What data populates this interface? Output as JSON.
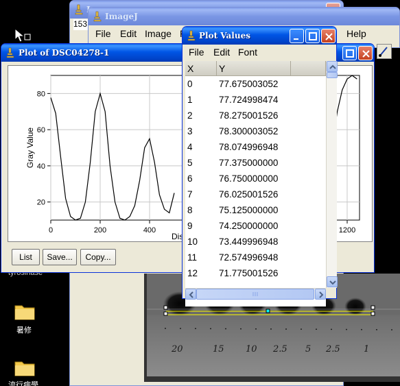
{
  "imagej_back": {
    "title": "I",
    "field_value": "153"
  },
  "imagej": {
    "title": "ImageJ",
    "menu": [
      "File",
      "Edit",
      "Image",
      "P",
      "Help"
    ]
  },
  "desktop": {
    "icons": [
      {
        "label": "tyrosinase",
        "icon": "folder-icon"
      },
      {
        "label": "暑修",
        "icon": "folder-icon"
      },
      {
        "label": "流行病學",
        "icon": "folder-icon"
      }
    ]
  },
  "plot_window": {
    "title": "Plot of DSC04278-1",
    "buttons": [
      "List",
      "Save...",
      "Copy..."
    ],
    "chart_data": {
      "type": "line",
      "xlabel": "Dis",
      "ylabel": "Gray Value",
      "xlim": [
        0,
        1250
      ],
      "ylim": [
        10,
        90
      ],
      "x_ticks": [
        "0",
        "200",
        "400",
        "1200"
      ],
      "y_ticks": [
        "20",
        "40",
        "60",
        "80"
      ],
      "grid": true,
      "x": [
        0,
        20,
        40,
        60,
        80,
        100,
        120,
        140,
        160,
        180,
        200,
        220,
        240,
        260,
        280,
        300,
        320,
        340,
        360,
        380,
        400,
        420,
        440,
        460,
        480,
        500
      ],
      "y": [
        77.7,
        69,
        45,
        22,
        12,
        10,
        11,
        20,
        42,
        70,
        80,
        70,
        40,
        20,
        11,
        10,
        12,
        18,
        32,
        50,
        55,
        42,
        24,
        16,
        14,
        25
      ]
    },
    "chart_data_right": {
      "x": [
        1120,
        1140,
        1160,
        1180,
        1200,
        1220,
        1240
      ],
      "y": [
        40,
        52,
        70,
        82,
        88,
        90,
        88
      ]
    }
  },
  "values_window": {
    "title": "Plot Values",
    "menu": [
      "File",
      "Edit",
      "Font"
    ],
    "columns": [
      "X",
      "Y"
    ],
    "rows": [
      [
        "0",
        "77.675003052"
      ],
      [
        "1",
        "77.724998474"
      ],
      [
        "2",
        "78.275001526"
      ],
      [
        "3",
        "78.300003052"
      ],
      [
        "4",
        "78.074996948"
      ],
      [
        "5",
        "77.375000000"
      ],
      [
        "6",
        "76.750000000"
      ],
      [
        "7",
        "76.025001526"
      ],
      [
        "8",
        "75.125000000"
      ],
      [
        "9",
        "74.250000000"
      ],
      [
        "10",
        "73.449996948"
      ],
      [
        "11",
        "72.574996948"
      ],
      [
        "12",
        "71.775001526"
      ]
    ]
  },
  "photo": {
    "handwritten_labels": [
      "20",
      "15",
      "10",
      "2.5",
      "5",
      "2.5",
      "1"
    ]
  }
}
